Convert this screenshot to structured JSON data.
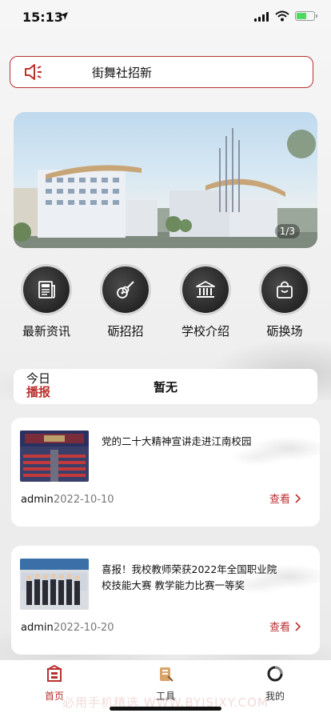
{
  "status_bar": {
    "time": "15:13"
  },
  "notice": {
    "text": "街舞社招新"
  },
  "banner": {
    "page_indicator": "1/3"
  },
  "menu": [
    {
      "label": "最新资讯",
      "icon": "newspaper-icon"
    },
    {
      "label": "砺招招",
      "icon": "guitar-icon"
    },
    {
      "label": "学校介绍",
      "icon": "school-building-icon"
    },
    {
      "label": "砺换场",
      "icon": "shopping-bag-icon"
    }
  ],
  "today": {
    "tag_line1": "今日",
    "tag_line2": "播报",
    "message": "暂无"
  },
  "news": [
    {
      "title": "党的二十大精神宣讲走进江南校园",
      "author": "admin",
      "date": "2022-10-10",
      "view_label": "查看"
    },
    {
      "title": "喜报！我校教师荣获2022年全国职业院校技能大赛 教学能力比赛一等奖",
      "author": "admin",
      "date": "2022-10-20",
      "view_label": "查看"
    }
  ],
  "tabbar": {
    "tabs": [
      {
        "label": "首页",
        "icon": "home-icon",
        "active": true
      },
      {
        "label": "工具",
        "icon": "tools-icon",
        "active": false
      },
      {
        "label": "我的",
        "icon": "profile-icon",
        "active": false
      }
    ],
    "watermark": "必用手机精选 WWW.BYJSJXY.COM"
  },
  "colors": {
    "accent": "#b9312f",
    "menu_badge": "#2b2b2b"
  }
}
